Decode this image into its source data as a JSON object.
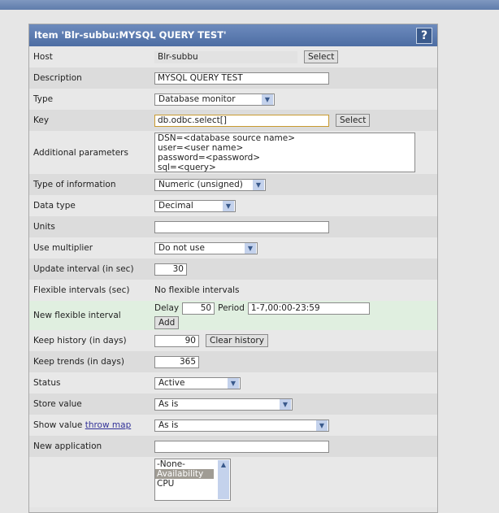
{
  "title": "Item 'Blr-subbu:MYSQL QUERY TEST'",
  "help": "?",
  "host": {
    "label": "Host",
    "value": "Blr-subbu",
    "button": "Select"
  },
  "description": {
    "label": "Description",
    "value": "MYSQL QUERY TEST"
  },
  "type": {
    "label": "Type",
    "value": "Database monitor"
  },
  "key": {
    "label": "Key",
    "value": "db.odbc.select[]",
    "button": "Select"
  },
  "params": {
    "label": "Additional parameters",
    "lines": [
      "DSN=<database source name>",
      "user=<user name>",
      "password=<password>",
      "sql=<query>"
    ]
  },
  "type_info": {
    "label": "Type of information",
    "value": "Numeric (unsigned)"
  },
  "data_type": {
    "label": "Data type",
    "value": "Decimal"
  },
  "units": {
    "label": "Units",
    "value": ""
  },
  "multiplier": {
    "label": "Use multiplier",
    "value": "Do not use"
  },
  "update": {
    "label": "Update interval (in sec)",
    "value": "30"
  },
  "flex": {
    "label": "Flexible intervals (sec)",
    "value": "No flexible intervals"
  },
  "new_flex": {
    "label": "New flexible interval",
    "delay_label": "Delay",
    "delay": "50",
    "period_label": "Period",
    "period": "1-7,00:00-23:59",
    "button": "Add"
  },
  "history": {
    "label": "Keep history (in days)",
    "value": "90",
    "button": "Clear history"
  },
  "trends": {
    "label": "Keep trends (in days)",
    "value": "365"
  },
  "status": {
    "label": "Status",
    "value": "Active"
  },
  "store": {
    "label": "Store value",
    "value": "As is"
  },
  "show": {
    "label": "Show value",
    "link": "throw map",
    "value": "As is"
  },
  "new_app": {
    "label": "New application",
    "value": ""
  },
  "applications": {
    "options": [
      "-None-",
      "Availability",
      "CPU"
    ],
    "selected": "Availability"
  }
}
